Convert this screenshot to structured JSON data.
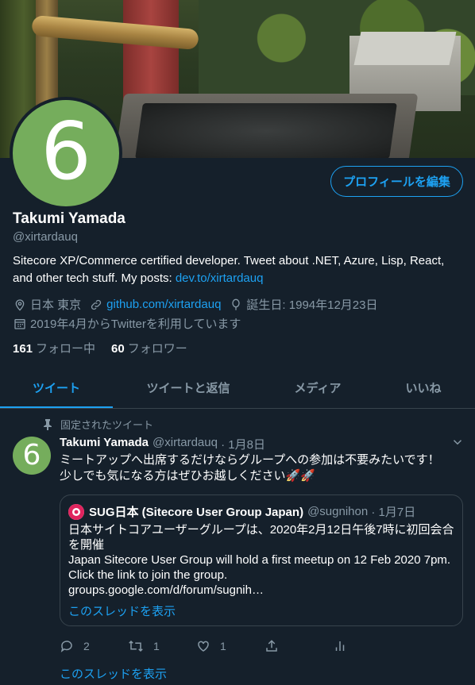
{
  "profile": {
    "avatar_digit": "6",
    "edit_button": "プロフィールを編集",
    "name": "Takumi Yamada",
    "handle": "@xirtardauq",
    "bio_text": "Sitecore XP/Commerce certified developer. Tweet about .NET, Azure, Lisp, React, and other tech stuff. My posts: ",
    "bio_link": "dev.to/xirtardauq",
    "location": "日本 東京",
    "website": "github.com/xirtardauq",
    "birthday": "誕生日: 1994年12月23日",
    "joined": "2019年4月からTwitterを利用しています",
    "following_count": "161",
    "following_label": "フォロー中",
    "followers_count": "60",
    "followers_label": "フォロワー"
  },
  "tabs": [
    {
      "label": "ツイート",
      "active": true
    },
    {
      "label": "ツイートと返信",
      "active": false
    },
    {
      "label": "メディア",
      "active": false
    },
    {
      "label": "いいね",
      "active": false
    }
  ],
  "tweet": {
    "pinned_label": "固定されたツイート",
    "avatar_digit": "6",
    "author_name": "Takumi Yamada",
    "author_handle": "@xirtardauq",
    "date": "· 1月8日",
    "text_line1": "ミートアップへ出席するだけならグループへの参加は不要みたいです！",
    "text_line2": "少しでも気になる方はぜひお越しください🚀🚀",
    "quote": {
      "author_name": "SUG日本 (Sitecore User Group Japan)",
      "author_handle": "@sugnihon",
      "date": "· 1月7日",
      "line1": "日本サイトコアユーザーグループは、2020年2月12日午後7時に初回会合を開催",
      "line2": "Japan Sitecore User Group will hold a first meetup on 12 Feb 2020 7pm. Click the link to join the group.",
      "line3": "groups.google.com/d/forum/sugnih…",
      "show_thread": "このスレッドを表示"
    },
    "replies": "2",
    "retweets": "1",
    "likes": "1",
    "show_thread": "このスレッドを表示"
  },
  "colors": {
    "accent": "#1da1f2",
    "background": "#15202b",
    "muted": "#8899a6",
    "avatar": "#75ad5c"
  }
}
